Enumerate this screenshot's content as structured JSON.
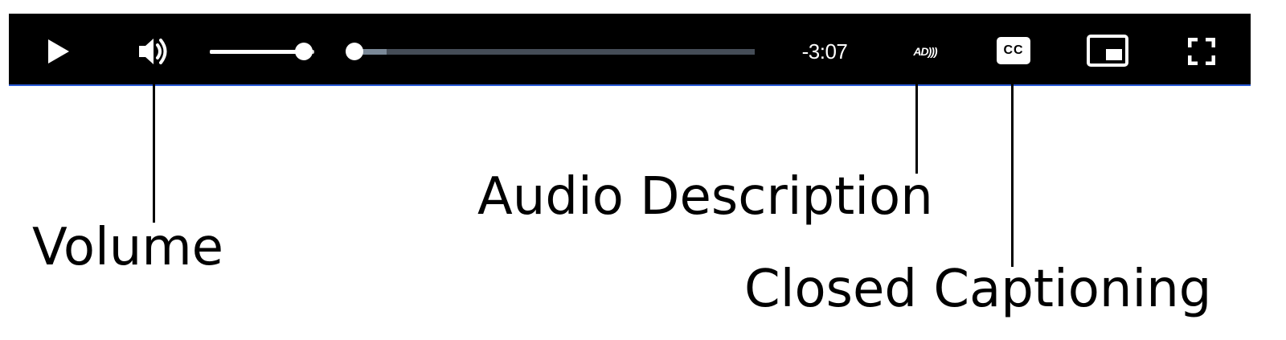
{
  "player": {
    "play_button_icon": "play-icon",
    "volume_button_icon": "speaker-volume-icon",
    "volume_level": 0.9,
    "playback_position": 0.0,
    "buffered": 0.08,
    "time_remaining": "-3:07",
    "audio_description_label": "AD",
    "audio_description_icon": "audio-description-icon",
    "closed_captions_label": "CC",
    "closed_captions_icon": "closed-captions-icon",
    "pip_icon": "picture-in-picture-icon",
    "fullscreen_icon": "fullscreen-icon"
  },
  "callouts": {
    "volume": "Volume",
    "audio_description": "Audio Description",
    "closed_captioning": "Closed Captioning"
  },
  "colors": {
    "bar_background": "#000000",
    "bar_border": "#2a5bd7",
    "icon": "#ffffff",
    "progress_track": "#454d57",
    "progress_buffer": "#7a8897"
  }
}
